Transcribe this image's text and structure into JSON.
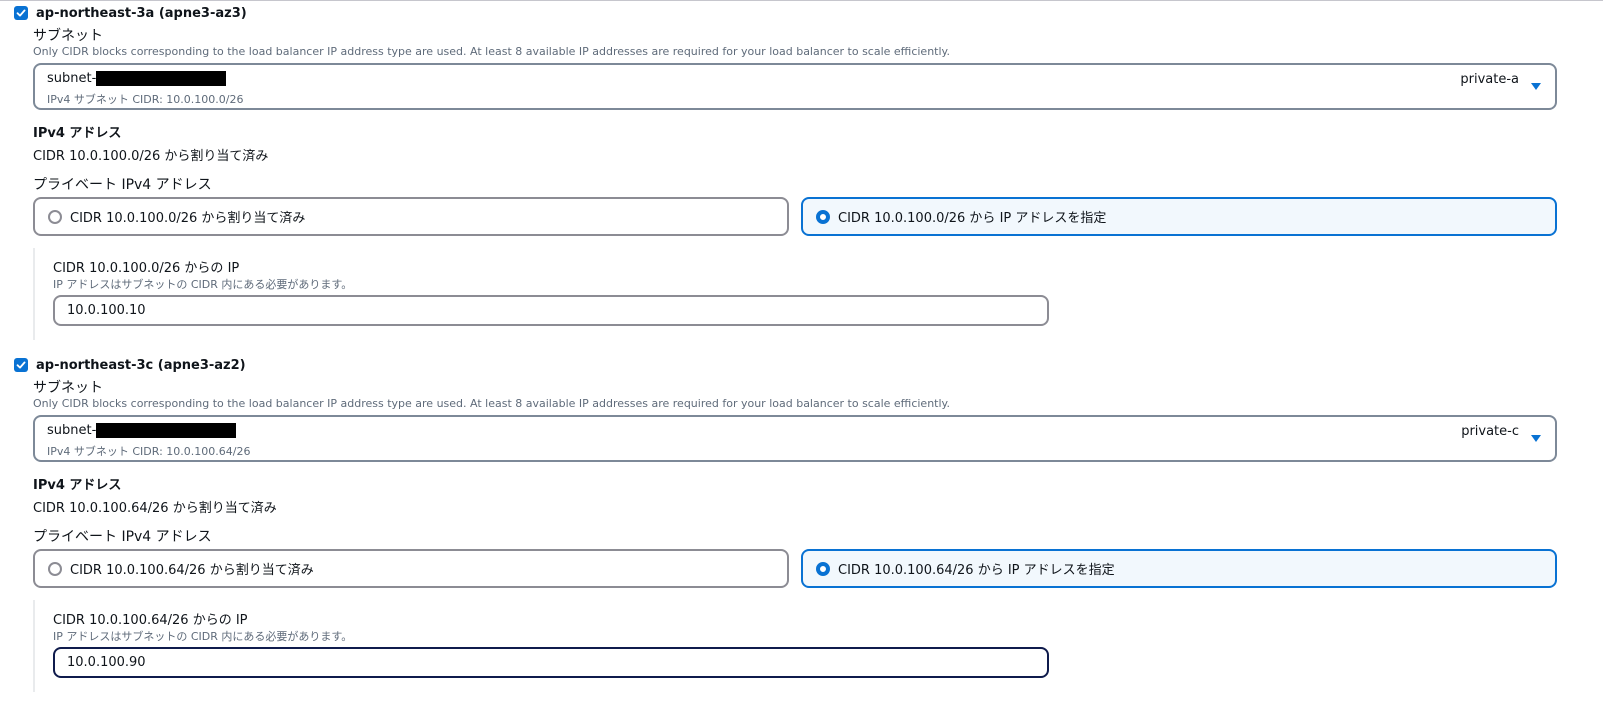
{
  "zones": [
    {
      "az_label": "ap-northeast-3a (apne3-az3)",
      "subnet_label": "サブネット",
      "subnet_description": "Only CIDR blocks corresponding to the load balancer IP address type are used. At least 8 available IP addresses are required for your load balancer to scale efficiently.",
      "subnet_prefix": "subnet-",
      "subnet_cidr_text": "IPv4 サブネット CIDR: 10.0.100.0/26",
      "subnet_tag": "private-a",
      "ipv4_heading": "IPv4 アドレス",
      "ipv4_value": "CIDR 10.0.100.0/26 から割り当て済み",
      "private_label": "プライベート IPv4 アドレス",
      "option_assigned": "CIDR 10.0.100.0/26 から割り当て済み",
      "option_specify": "CIDR 10.0.100.0/26 から IP アドレスを指定",
      "ip_label": "CIDR 10.0.100.0/26 からの IP",
      "ip_description": "IP アドレスはサブネットの CIDR 内にある必要があります。",
      "ip_value": "10.0.100.10"
    },
    {
      "az_label": "ap-northeast-3c (apne3-az2)",
      "subnet_label": "サブネット",
      "subnet_description": "Only CIDR blocks corresponding to the load balancer IP address type are used. At least 8 available IP addresses are required for your load balancer to scale efficiently.",
      "subnet_prefix": "subnet-",
      "subnet_cidr_text": "IPv4 サブネット CIDR: 10.0.100.64/26",
      "subnet_tag": "private-c",
      "ipv4_heading": "IPv4 アドレス",
      "ipv4_value": "CIDR 10.0.100.64/26 から割り当て済み",
      "private_label": "プライベート IPv4 アドレス",
      "option_assigned": "CIDR 10.0.100.64/26 から割り当て済み",
      "option_specify": "CIDR 10.0.100.64/26 から IP アドレスを指定",
      "ip_label": "CIDR 10.0.100.64/26 からの IP",
      "ip_description": "IP アドレスはサブネットの CIDR 内にある必要があります。",
      "ip_value": "10.0.100.90"
    }
  ],
  "icons": {
    "checkbox": "checkmark-icon",
    "dropdown": "caret-down-icon"
  },
  "colors": {
    "accent": "#0972d3",
    "selected_tile_bg": "#f2f8fd",
    "text": "#0f141a",
    "muted_text": "#5f6b7a",
    "border": "#8c8c94",
    "focus_border": "#0f1b4c"
  }
}
